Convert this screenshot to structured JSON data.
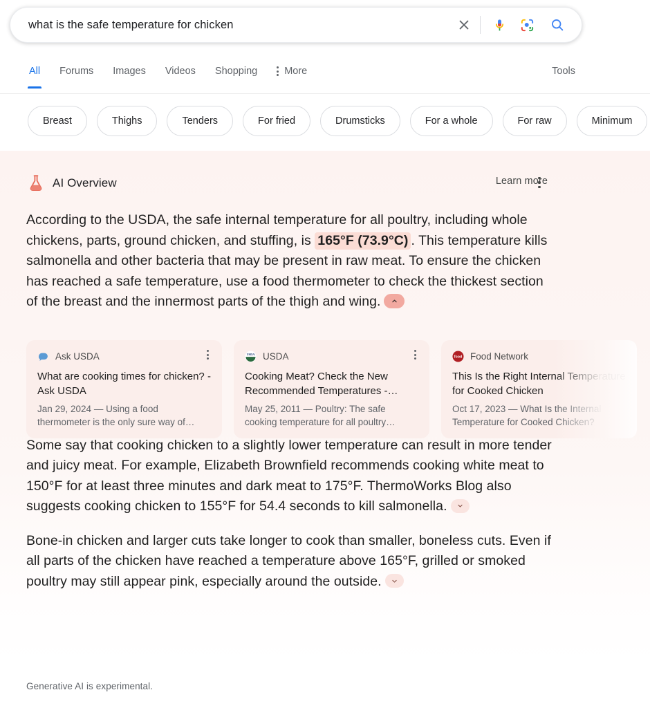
{
  "search": {
    "query": "what is the safe temperature for chicken",
    "placeholder": "Search",
    "clear_icon": "close-icon",
    "mic_icon": "microphone-icon",
    "lens_icon": "google-lens-icon",
    "search_icon": "search-icon"
  },
  "nav": {
    "items": [
      {
        "label": "All",
        "active": true
      },
      {
        "label": "Forums",
        "active": false
      },
      {
        "label": "Images",
        "active": false
      },
      {
        "label": "Videos",
        "active": false
      },
      {
        "label": "Shopping",
        "active": false
      }
    ],
    "more_label": "More",
    "tools_label": "Tools",
    "active_color": "#1a73e8"
  },
  "chips": [
    {
      "label": "Breast"
    },
    {
      "label": "Thighs"
    },
    {
      "label": "Tenders"
    },
    {
      "label": "For fried"
    },
    {
      "label": "Drumsticks"
    },
    {
      "label": "For a whole"
    },
    {
      "label": "For raw"
    },
    {
      "label": "Minimum"
    }
  ],
  "ai_overview": {
    "title": "AI Overview",
    "learn_more_label": "Learn more",
    "flask_icon": "flask-icon",
    "menu_icon": "kebab-menu-icon",
    "accent_color": "#e8705f",
    "panel_bg": "#fdf5f3",
    "card_bg": "#fbeeeb",
    "highlight_bg": "#fbdcd4",
    "paragraph_1": {
      "before": "According to the USDA, the safe internal temperature for all poultry, including whole chickens, parts, ground chicken, and stuffing, is ",
      "highlight": "165°F (73.9°C)",
      "after": ". This temperature kills salmonella and other bacteria that may be present in raw meat. To ensure the chicken has reached a safe temperature, use a food thermometer to check the thickest section of the breast and the innermost parts of the thigh and wing.",
      "toggle_state": "expanded",
      "toggle_icon": "chevron-up-icon"
    },
    "paragraph_2": {
      "text": "Some say that cooking chicken to a slightly lower temperature can result in more tender and juicy meat. For example, Elizabeth Brownfield recommends cooking white meat to 150°F for at least three minutes and dark meat to 175°F. ThermoWorks Blog also suggests cooking chicken to 155°F for 54.4 seconds to kill salmonella.",
      "toggle_state": "collapsed",
      "toggle_icon": "chevron-down-icon"
    },
    "paragraph_3": {
      "text": "Bone-in chicken and larger cuts take longer to cook than smaller, boneless cuts. Even if all parts of the chicken have reached a temperature above 165°F, grilled or smoked poultry may still appear pink, especially around the outside.",
      "toggle_state": "collapsed",
      "toggle_icon": "chevron-down-icon"
    },
    "cards": [
      {
        "source": "Ask USDA",
        "favicon": "ask-usda-favicon",
        "title": "What are cooking times for chicken? - Ask USDA",
        "snippet": "Jan 29, 2024 — Using a food thermometer is the only sure way of…"
      },
      {
        "source": "USDA",
        "favicon": "usda-favicon",
        "title": "Cooking Meat? Check the New Recommended Temperatures -…",
        "snippet": "May 25, 2011 — Poultry: The safe cooking temperature for all poultry…"
      },
      {
        "source": "Food Network",
        "favicon": "food-network-favicon",
        "title": "This Is the Right Internal Temperature for Cooked Chicken",
        "snippet": "Oct 17, 2023 — What Is the Internal Temperature for Cooked Chicken?"
      }
    ],
    "footer": "Generative AI is experimental."
  }
}
